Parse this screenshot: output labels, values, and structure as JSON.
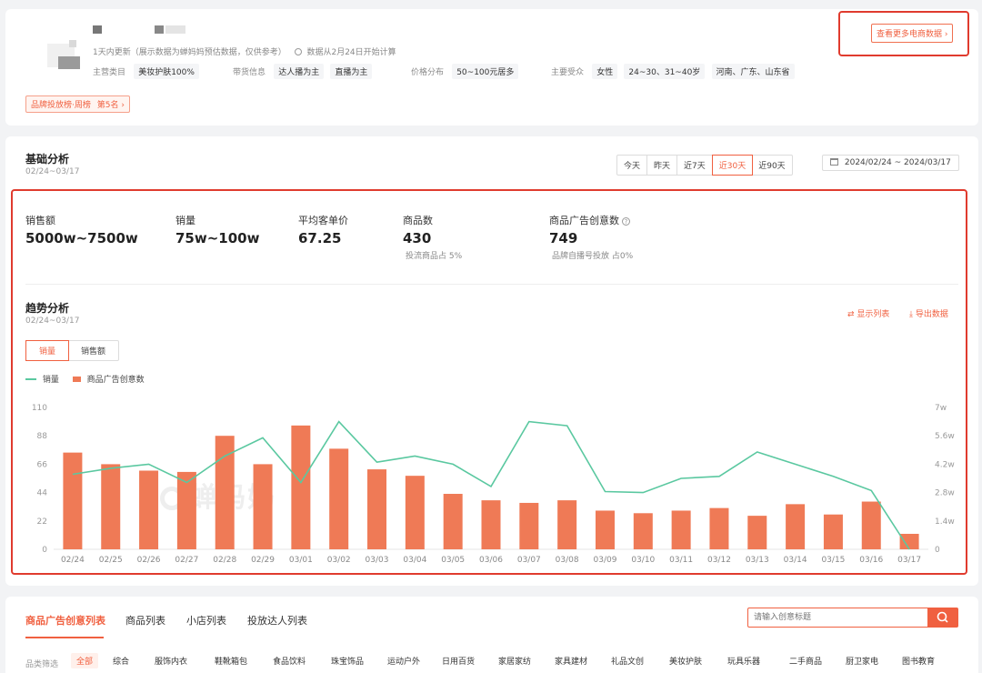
{
  "profile": {
    "update_note": "1天内更新（展示数据为蝉妈妈预估数据，仅供参考）",
    "start_note": "数据从2月24日开始计算",
    "main_category_label": "主营类目",
    "main_category_value": "美妆护肤100%",
    "selling_label": "带货信息",
    "selling_tags": [
      "达人播为主",
      "直播为主"
    ],
    "price_label": "价格分布",
    "price_value": "50~100元居多",
    "audience_label": "主要受众",
    "audience_tags": [
      "女性",
      "24~30、31~40岁",
      "河南、广东、山东省"
    ],
    "rank_badge_text": "品牌投放榜·周榜",
    "rank_badge_rank": "第5名",
    "more_button": "查看更多电商数据 ›"
  },
  "basic": {
    "title": "基础分析",
    "date_range": "02/24~03/17",
    "ranges": [
      "今天",
      "昨天",
      "近7天",
      "近30天",
      "近90天"
    ],
    "active_range": "近30天",
    "date_picker": "2024/02/24 ~ 2024/03/17"
  },
  "kpis": [
    {
      "label": "销售额",
      "value": "5000w~7500w",
      "sub": ""
    },
    {
      "label": "销量",
      "value": "75w~100w",
      "sub": ""
    },
    {
      "label": "平均客单价",
      "value": "67.25",
      "sub": ""
    },
    {
      "label": "商品数",
      "value": "430",
      "sub": "投流商品占 5%"
    },
    {
      "label": "商品广告创意数",
      "value": "749",
      "sub": "品牌自播号投放 占0%"
    }
  ],
  "trend": {
    "title": "趋势分析",
    "date_range": "02/24~03/17",
    "show_list": "显示列表",
    "export": "导出数据",
    "toggle": [
      "销量",
      "销售额"
    ],
    "watermark": "蝉妈妈"
  },
  "colors": {
    "accent": "#f06040",
    "bar": "#ef7a56",
    "line": "#5ac8a0",
    "frame": "#e03b2e"
  },
  "chart_data": {
    "type": "bar",
    "categories": [
      "02/24",
      "02/25",
      "02/26",
      "02/27",
      "02/28",
      "02/29",
      "03/01",
      "03/02",
      "03/03",
      "03/04",
      "03/05",
      "03/06",
      "03/07",
      "03/08",
      "03/09",
      "03/10",
      "03/11",
      "03/12",
      "03/13",
      "03/14",
      "03/15",
      "03/16",
      "03/17"
    ],
    "series": [
      {
        "name": "商品广告创意数",
        "axis": "left",
        "type": "bar",
        "values": [
          75,
          66,
          61,
          60,
          88,
          66,
          96,
          78,
          62,
          57,
          43,
          38,
          36,
          38,
          30,
          28,
          30,
          32,
          26,
          35,
          27,
          37,
          12
        ]
      },
      {
        "name": "销量",
        "axis": "right",
        "type": "line",
        "values": [
          37000,
          40000,
          42000,
          33000,
          46000,
          55000,
          33000,
          63000,
          43000,
          46000,
          42000,
          31000,
          63000,
          61000,
          28500,
          28000,
          35000,
          36000,
          48000,
          42000,
          36000,
          29000,
          0
        ]
      }
    ],
    "left_ticks": [
      "0",
      "22",
      "44",
      "66",
      "88",
      "110"
    ],
    "right_ticks": [
      "0",
      "1.4w",
      "2.8w",
      "4.2w",
      "5.6w",
      "7w"
    ],
    "ylim_left": [
      0,
      110
    ],
    "ylim_right": [
      0,
      70000
    ],
    "legend_position": "top-left"
  },
  "bottom": {
    "tabs": [
      "商品广告创意列表",
      "商品列表",
      "小店列表",
      "投放达人列表"
    ],
    "active_tab": "商品广告创意列表",
    "search_placeholder": "请输入创意标题",
    "filter_label": "品类筛选",
    "categories": [
      "全部",
      "综合",
      "服饰内衣",
      "鞋靴箱包",
      "食品饮料",
      "珠宝饰品",
      "运动户外",
      "日用百货",
      "家居家纺",
      "家具建材",
      "礼品文创",
      "美妆护肤",
      "玩具乐器",
      "二手商品",
      "厨卫家电",
      "图书教育"
    ]
  }
}
